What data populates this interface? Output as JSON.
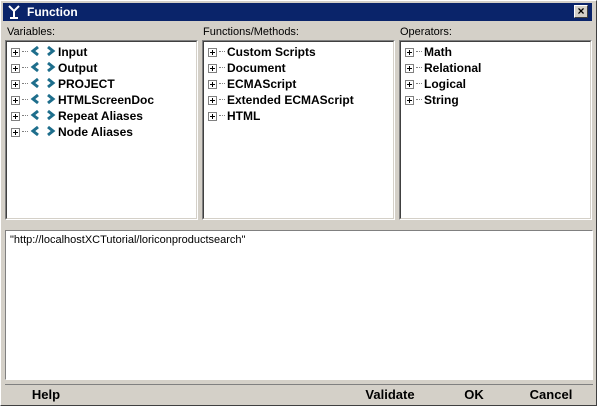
{
  "window": {
    "title": "Function",
    "close_label": "×"
  },
  "variables": {
    "label": "Variables:",
    "items": [
      "Input",
      "Output",
      "PROJECT",
      "HTMLScreenDoc",
      "Repeat Aliases",
      "Node Aliases"
    ]
  },
  "functions": {
    "label": "Functions/Methods:",
    "items": [
      "Custom Scripts",
      "Document",
      "ECMAScript",
      "Extended ECMAScript",
      "HTML"
    ]
  },
  "operators": {
    "label": "Operators:",
    "items": [
      "Math",
      "Relational",
      "Logical",
      "String"
    ]
  },
  "editor": {
    "value": "\"http://localhostXCTutorial/loriconproductsearch\""
  },
  "buttons": {
    "help": "Help",
    "validate": "Validate",
    "ok": "OK",
    "cancel": "Cancel"
  },
  "icons": {
    "title": "function-app-icon",
    "variable": "variable-brackets-icon",
    "expander": "plus-box-icon"
  },
  "colors": {
    "titlebar": "#0a246a",
    "variable_icon": "#1e6e8c",
    "background": "#d4d0c8"
  }
}
